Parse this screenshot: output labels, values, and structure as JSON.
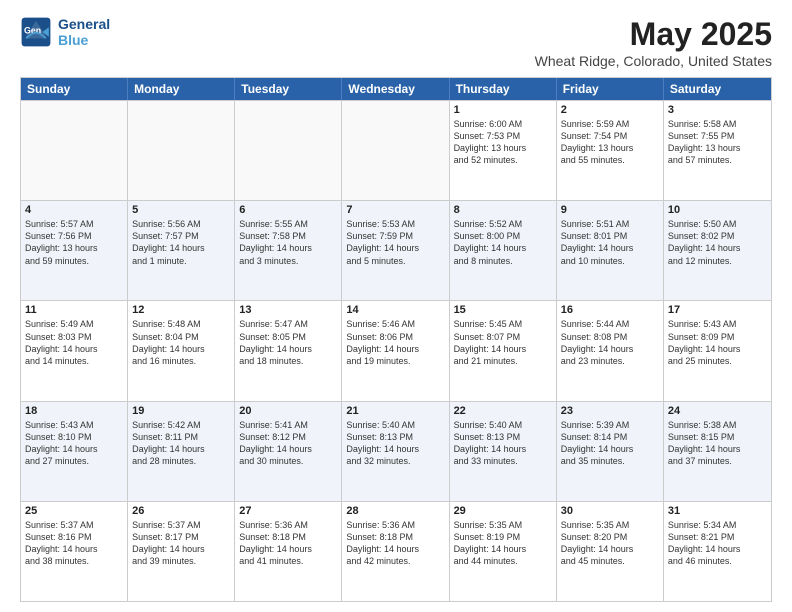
{
  "header": {
    "logo_line1": "General",
    "logo_line2": "Blue",
    "month": "May 2025",
    "location": "Wheat Ridge, Colorado, United States"
  },
  "weekdays": [
    "Sunday",
    "Monday",
    "Tuesday",
    "Wednesday",
    "Thursday",
    "Friday",
    "Saturday"
  ],
  "rows": [
    [
      {
        "day": "",
        "info": ""
      },
      {
        "day": "",
        "info": ""
      },
      {
        "day": "",
        "info": ""
      },
      {
        "day": "",
        "info": ""
      },
      {
        "day": "1",
        "info": "Sunrise: 6:00 AM\nSunset: 7:53 PM\nDaylight: 13 hours\nand 52 minutes."
      },
      {
        "day": "2",
        "info": "Sunrise: 5:59 AM\nSunset: 7:54 PM\nDaylight: 13 hours\nand 55 minutes."
      },
      {
        "day": "3",
        "info": "Sunrise: 5:58 AM\nSunset: 7:55 PM\nDaylight: 13 hours\nand 57 minutes."
      }
    ],
    [
      {
        "day": "4",
        "info": "Sunrise: 5:57 AM\nSunset: 7:56 PM\nDaylight: 13 hours\nand 59 minutes."
      },
      {
        "day": "5",
        "info": "Sunrise: 5:56 AM\nSunset: 7:57 PM\nDaylight: 14 hours\nand 1 minute."
      },
      {
        "day": "6",
        "info": "Sunrise: 5:55 AM\nSunset: 7:58 PM\nDaylight: 14 hours\nand 3 minutes."
      },
      {
        "day": "7",
        "info": "Sunrise: 5:53 AM\nSunset: 7:59 PM\nDaylight: 14 hours\nand 5 minutes."
      },
      {
        "day": "8",
        "info": "Sunrise: 5:52 AM\nSunset: 8:00 PM\nDaylight: 14 hours\nand 8 minutes."
      },
      {
        "day": "9",
        "info": "Sunrise: 5:51 AM\nSunset: 8:01 PM\nDaylight: 14 hours\nand 10 minutes."
      },
      {
        "day": "10",
        "info": "Sunrise: 5:50 AM\nSunset: 8:02 PM\nDaylight: 14 hours\nand 12 minutes."
      }
    ],
    [
      {
        "day": "11",
        "info": "Sunrise: 5:49 AM\nSunset: 8:03 PM\nDaylight: 14 hours\nand 14 minutes."
      },
      {
        "day": "12",
        "info": "Sunrise: 5:48 AM\nSunset: 8:04 PM\nDaylight: 14 hours\nand 16 minutes."
      },
      {
        "day": "13",
        "info": "Sunrise: 5:47 AM\nSunset: 8:05 PM\nDaylight: 14 hours\nand 18 minutes."
      },
      {
        "day": "14",
        "info": "Sunrise: 5:46 AM\nSunset: 8:06 PM\nDaylight: 14 hours\nand 19 minutes."
      },
      {
        "day": "15",
        "info": "Sunrise: 5:45 AM\nSunset: 8:07 PM\nDaylight: 14 hours\nand 21 minutes."
      },
      {
        "day": "16",
        "info": "Sunrise: 5:44 AM\nSunset: 8:08 PM\nDaylight: 14 hours\nand 23 minutes."
      },
      {
        "day": "17",
        "info": "Sunrise: 5:43 AM\nSunset: 8:09 PM\nDaylight: 14 hours\nand 25 minutes."
      }
    ],
    [
      {
        "day": "18",
        "info": "Sunrise: 5:43 AM\nSunset: 8:10 PM\nDaylight: 14 hours\nand 27 minutes."
      },
      {
        "day": "19",
        "info": "Sunrise: 5:42 AM\nSunset: 8:11 PM\nDaylight: 14 hours\nand 28 minutes."
      },
      {
        "day": "20",
        "info": "Sunrise: 5:41 AM\nSunset: 8:12 PM\nDaylight: 14 hours\nand 30 minutes."
      },
      {
        "day": "21",
        "info": "Sunrise: 5:40 AM\nSunset: 8:13 PM\nDaylight: 14 hours\nand 32 minutes."
      },
      {
        "day": "22",
        "info": "Sunrise: 5:40 AM\nSunset: 8:13 PM\nDaylight: 14 hours\nand 33 minutes."
      },
      {
        "day": "23",
        "info": "Sunrise: 5:39 AM\nSunset: 8:14 PM\nDaylight: 14 hours\nand 35 minutes."
      },
      {
        "day": "24",
        "info": "Sunrise: 5:38 AM\nSunset: 8:15 PM\nDaylight: 14 hours\nand 37 minutes."
      }
    ],
    [
      {
        "day": "25",
        "info": "Sunrise: 5:37 AM\nSunset: 8:16 PM\nDaylight: 14 hours\nand 38 minutes."
      },
      {
        "day": "26",
        "info": "Sunrise: 5:37 AM\nSunset: 8:17 PM\nDaylight: 14 hours\nand 39 minutes."
      },
      {
        "day": "27",
        "info": "Sunrise: 5:36 AM\nSunset: 8:18 PM\nDaylight: 14 hours\nand 41 minutes."
      },
      {
        "day": "28",
        "info": "Sunrise: 5:36 AM\nSunset: 8:18 PM\nDaylight: 14 hours\nand 42 minutes."
      },
      {
        "day": "29",
        "info": "Sunrise: 5:35 AM\nSunset: 8:19 PM\nDaylight: 14 hours\nand 44 minutes."
      },
      {
        "day": "30",
        "info": "Sunrise: 5:35 AM\nSunset: 8:20 PM\nDaylight: 14 hours\nand 45 minutes."
      },
      {
        "day": "31",
        "info": "Sunrise: 5:34 AM\nSunset: 8:21 PM\nDaylight: 14 hours\nand 46 minutes."
      }
    ]
  ]
}
